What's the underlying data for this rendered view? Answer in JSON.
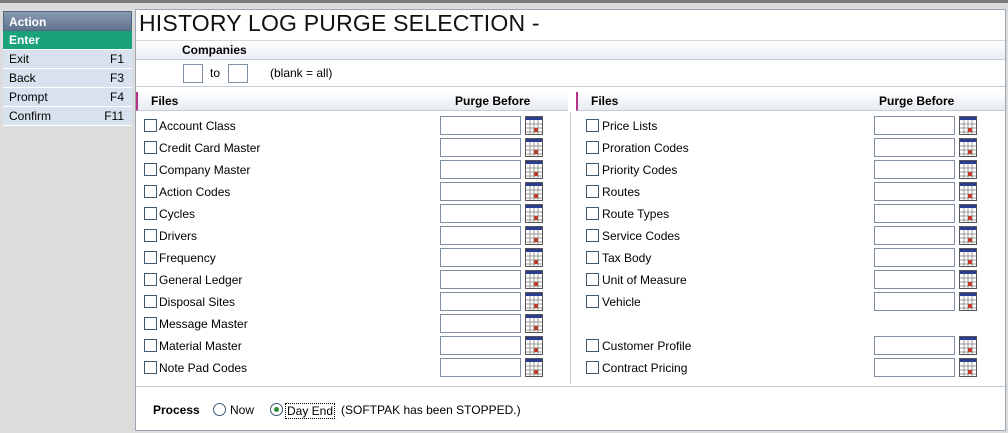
{
  "sidebar": {
    "header": "Action",
    "items": [
      {
        "label": "Enter",
        "key": ""
      },
      {
        "label": "Exit",
        "key": "F1"
      },
      {
        "label": "Back",
        "key": "F3"
      },
      {
        "label": "Prompt",
        "key": "F4"
      },
      {
        "label": "Confirm",
        "key": "F11"
      }
    ]
  },
  "page": {
    "title": "HISTORY LOG PURGE SELECTION -"
  },
  "companies": {
    "label": "Companies",
    "from_value": "",
    "to_label": "to",
    "to_value": "",
    "note": "(blank = all)"
  },
  "headers": {
    "files": "Files",
    "purge_before": "Purge Before"
  },
  "left_files": [
    {
      "label": "Account Class",
      "value": ""
    },
    {
      "label": "Credit Card Master",
      "value": ""
    },
    {
      "label": "Company Master",
      "value": ""
    },
    {
      "label": "Action Codes",
      "value": ""
    },
    {
      "label": "Cycles",
      "value": ""
    },
    {
      "label": "Drivers",
      "value": ""
    },
    {
      "label": "Frequency",
      "value": ""
    },
    {
      "label": "General Ledger",
      "value": ""
    },
    {
      "label": "Disposal Sites",
      "value": ""
    },
    {
      "label": "Message Master",
      "value": ""
    },
    {
      "label": "Material Master",
      "value": ""
    },
    {
      "label": "Note Pad Codes",
      "value": ""
    }
  ],
  "right_files": [
    {
      "label": "Price Lists",
      "value": ""
    },
    {
      "label": "Proration Codes",
      "value": ""
    },
    {
      "label": "Priority Codes",
      "value": ""
    },
    {
      "label": "Routes",
      "value": ""
    },
    {
      "label": "Route Types",
      "value": ""
    },
    {
      "label": "Service Codes",
      "value": ""
    },
    {
      "label": "Tax Body",
      "value": ""
    },
    {
      "label": "Unit of Measure",
      "value": ""
    },
    {
      "label": "Vehicle",
      "value": ""
    },
    {
      "label": "Customer Profile",
      "value": ""
    },
    {
      "label": "Contract Pricing",
      "value": ""
    }
  ],
  "process": {
    "label": "Process",
    "options": [
      {
        "label": "Now",
        "selected": false
      },
      {
        "label": "Day End",
        "selected": true
      }
    ],
    "status": "(SOFTPAK has been STOPPED.)"
  },
  "colors": {
    "accent": "#1aa37a",
    "sidebar_header": "#6a7d98",
    "divider_accent": "#b8328a"
  }
}
